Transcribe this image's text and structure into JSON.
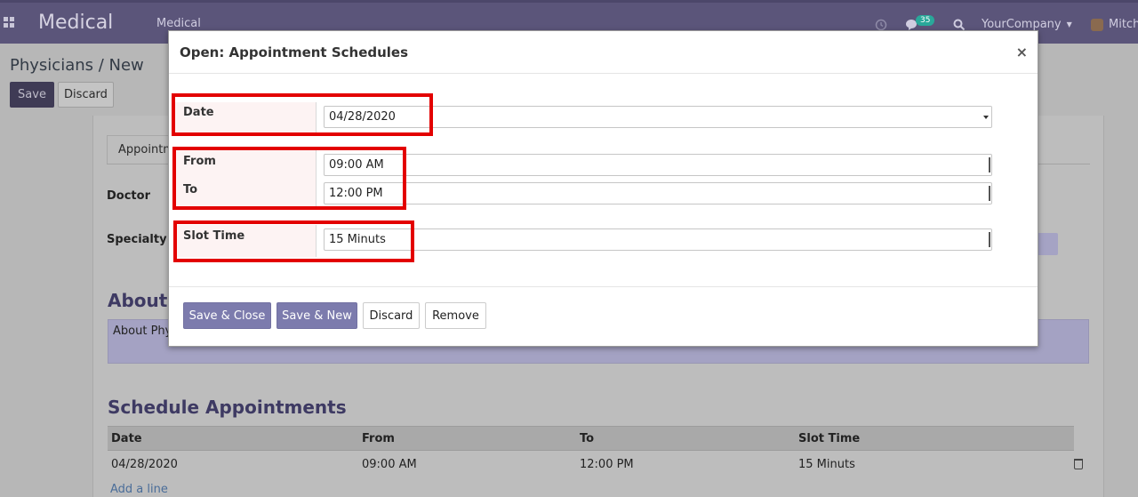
{
  "navbar": {
    "brand": "Medical",
    "menu_item": "Medical",
    "chat_badge": "35",
    "company": "YourCompany",
    "user": "Mitche"
  },
  "control": {
    "breadcrumb": "Physicians / New",
    "save_label": "Save",
    "discard_label": "Discard"
  },
  "sheet": {
    "tab_label": "Appointm",
    "doctor_label": "Doctor",
    "specialty_label": "Specialty",
    "about_heading": "About P",
    "about_text": "About Phys",
    "schedule_heading": "Schedule Appointments",
    "table": {
      "columns": [
        "Date",
        "From",
        "To",
        "Slot Time"
      ],
      "rows": [
        [
          "04/28/2020",
          "09:00 AM",
          "12:00 PM",
          "15 Minuts"
        ]
      ]
    },
    "add_line": "Add a line"
  },
  "modal": {
    "title": "Open: Appointment Schedules",
    "close_glyph": "×",
    "fields": {
      "date": {
        "label": "Date",
        "value": "04/28/2020"
      },
      "from": {
        "label": "From",
        "value": "09:00 AM"
      },
      "to": {
        "label": "To",
        "value": "12:00 PM"
      },
      "slot_time": {
        "label": "Slot Time",
        "value": "15 Minuts"
      }
    },
    "buttons": {
      "save_close": "Save & Close",
      "save_new": "Save & New",
      "discard": "Discard",
      "remove": "Remove"
    }
  },
  "colors": {
    "navbar": "#5b557a",
    "primary_button": "#7c7bad",
    "highlight": "#e30000"
  },
  "icons": [
    "apps-grid-icon",
    "clock-icon",
    "chat-icon",
    "search-icon",
    "caret-down-icon",
    "trash-icon",
    "close-icon"
  ]
}
